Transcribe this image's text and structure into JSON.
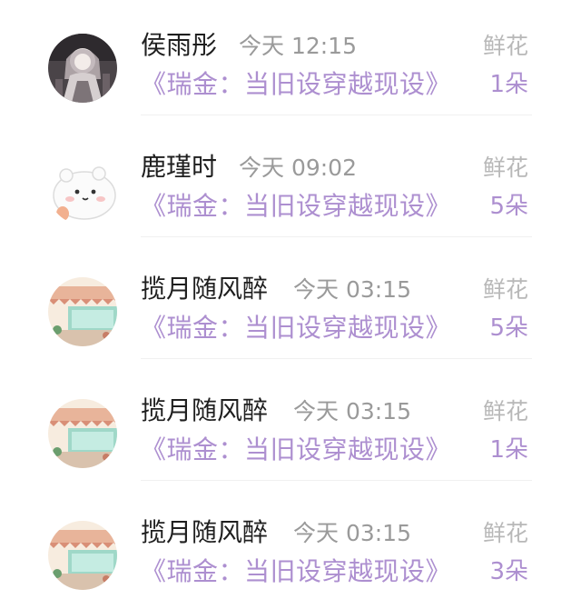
{
  "entries": [
    {
      "name": "侯雨彤",
      "time": "今天 12:15",
      "gift_type": "鲜花",
      "book": "《瑞金：当旧设穿越现设》",
      "count": "1朵",
      "avatar_icon": "gothic-girl-avatar-icon"
    },
    {
      "name": "鹿瑾时",
      "time": "今天 09:02",
      "gift_type": "鲜花",
      "book": "《瑞金：当旧设穿越现设》",
      "count": "5朵",
      "avatar_icon": "white-bear-avatar-icon"
    },
    {
      "name": "揽月随风醉",
      "time": "今天 03:15",
      "gift_type": "鲜花",
      "book": "《瑞金：当旧设穿越现设》",
      "count": "5朵",
      "avatar_icon": "cafe-storefront-avatar-icon"
    },
    {
      "name": "揽月随风醉",
      "time": "今天 03:15",
      "gift_type": "鲜花",
      "book": "《瑞金：当旧设穿越现设》",
      "count": "1朵",
      "avatar_icon": "cafe-storefront-avatar-icon"
    },
    {
      "name": "揽月随风醉",
      "time": "今天 03:15",
      "gift_type": "鲜花",
      "book": "《瑞金：当旧设穿越现设》",
      "count": "3朵",
      "avatar_icon": "cafe-storefront-avatar-icon"
    }
  ]
}
